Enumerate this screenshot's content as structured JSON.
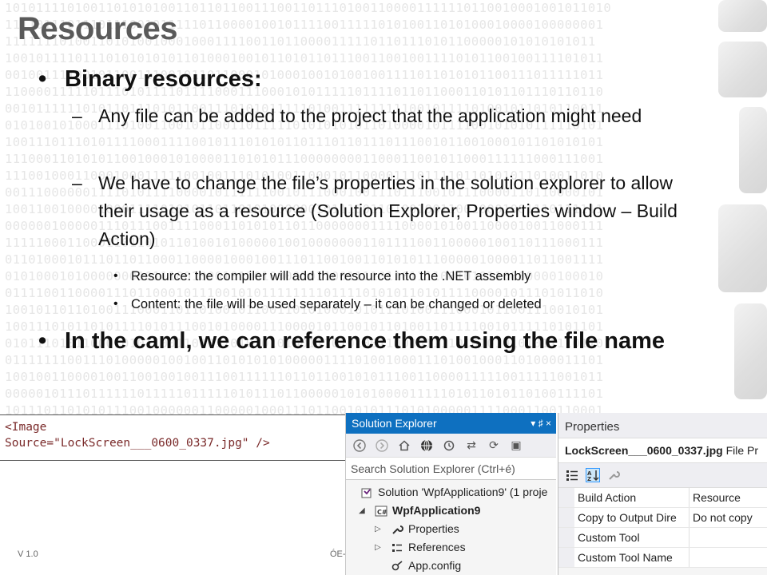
{
  "slide": {
    "title": "Resources",
    "bullets": [
      {
        "level": 1,
        "text": "Binary resources:"
      },
      {
        "level": 2,
        "text": "Any file can be added to the project that the application might need"
      },
      {
        "level": 2,
        "text": "We have to change the file’s properties in the solution explorer to allow their usage as a resource (Solution Explorer, Properties window – Build Action)"
      },
      {
        "level": 3,
        "text": "Resource: the compiler will add the resource into the .NET assembly"
      },
      {
        "level": 3,
        "text": "Content: the file will be used separately – it can be changed or deleted"
      },
      {
        "level": 1,
        "text": "In the caml, we can reference them using the file name"
      }
    ],
    "code": "<Image\nSource=\"LockScreen___0600_0337.jpg\" />",
    "footer_left": "V 1.0",
    "footer_mid": "ÓE-"
  },
  "background_binary": [
    "101011110100110101010011011011001110011011101001100001111110110010001001011010",
    "11110111011101110010111110110000100101111001111101010011010100010000100000001",
    "1111111010011010100100010001111001101100001111101101110101100000101010101011",
    "10010111101110101010101101000100101101011011100110010011110101100100111101011",
    "00100111100101100111001011011000101000100101001001111011010101100111011111011",
    "11000011111011101011110111100011100010101111101111011011000110101101110110110",
    "00101111110101101110101100111010101111101001111111110010111101001011010110011",
    "01010010100011101001100101100110111110101010101101000010111100101010111110101",
    "10011101110101111000111100101110101011011101101110111001011001000101101010101",
    "11100011010101100100010100001101010111000000001100011001011000111111000111001",
    "11100100011000100011111001001110101001100010110000111011110110101011010011010",
    "00111000000111101011110000101111110010111000100111011100101110000110110000101",
    "10011001000010001111010101101101010000001011100110100100110010001001110111111",
    "00000010000011101110011110001101010110110000000111100001010011000010011000111",
    "11111000110001101101011010010100000100100000001101111001100000100110111000111",
    "01101000101110110110001100001000100111011001001101010111000001000011011001111",
    "01010001010000000101110010001011010000101100111101101111001010110000000100010",
    "01111001100001110110001011100101011111111011110101011010111100001011101011010",
    "10010110110100111000110110100101100110101000101011101001110001011001110010101",
    "10011101011010111101011100101000011100001011001011010011011110010111110101101",
    "01011101011000101011001101011010101010011101010011000011110101010101011110110",
    "01111111001110100000100100110101010100000111101001000111010010001101000011101",
    "10010011000010011001001001110011111101101100101011100110000111110011111001011",
    "00000101110111111011111011111010111011000001010100001111101011010110100111101",
    "10111011010101110010000001100000100011101100101011101010000011110001100110001"
  ],
  "solution_explorer": {
    "title": "Solution Explorer",
    "pin_glyph": "▾ ♯ ×",
    "search_placeholder": "Search Solution Explorer (Ctrl+é)",
    "items": [
      {
        "label": "Solution 'WpfApplication9' (1 proje",
        "icon": "solution-icon",
        "bold": false
      },
      {
        "label": "WpfApplication9",
        "icon": "csharp-project-icon",
        "bold": true
      },
      {
        "label": "Properties",
        "icon": "wrench-icon",
        "bold": false
      },
      {
        "label": "References",
        "icon": "references-icon",
        "bold": false
      },
      {
        "label": "App.config",
        "icon": "config-icon",
        "bold": false
      }
    ]
  },
  "properties_panel": {
    "title": "Properties",
    "file_name": "LockScreen___0600_0337.jpg",
    "file_type": "File Pr",
    "rows": [
      {
        "name": "Build Action",
        "value": "Resource"
      },
      {
        "name": "Copy to Output Dire",
        "value": "Do not copy"
      },
      {
        "name": "Custom Tool",
        "value": ""
      },
      {
        "name": "Custom Tool Name",
        "value": ""
      }
    ]
  },
  "colors": {
    "title_gray": "#5a5a5a",
    "se_title_blue": "#0e70c0",
    "code_text": "#7a2a2a"
  }
}
